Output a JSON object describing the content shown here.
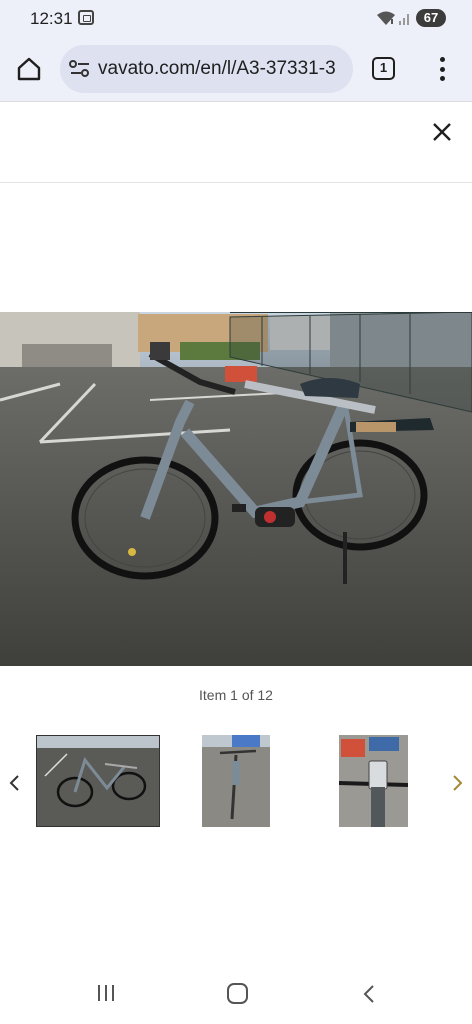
{
  "status_bar": {
    "time": "12:31",
    "battery": "67",
    "icons": [
      "screenshot-icon",
      "wifi-icon",
      "signal-icon",
      "battery-icon"
    ]
  },
  "browser": {
    "url": "vavato.com/en/l/A3-37331-3",
    "tab_count": "1",
    "icons": [
      "home-icon",
      "site-settings-icon",
      "tabs-icon",
      "more-vert-icon"
    ]
  },
  "gallery": {
    "counter": "Item 1 of 12",
    "current_index": 1,
    "total": 12,
    "thumbnails": [
      {
        "subject": "bike side view",
        "selected": true
      },
      {
        "subject": "bike front view",
        "selected": false
      },
      {
        "subject": "handlebar display",
        "selected": false
      }
    ]
  },
  "colors": {
    "browser_chrome": "#eef0f9",
    "url_pill": "#dde1f0",
    "arrow_next": "#a28a33"
  },
  "nav_bar": {
    "icons": [
      "recents-icon",
      "home-circle-icon",
      "back-icon"
    ]
  }
}
